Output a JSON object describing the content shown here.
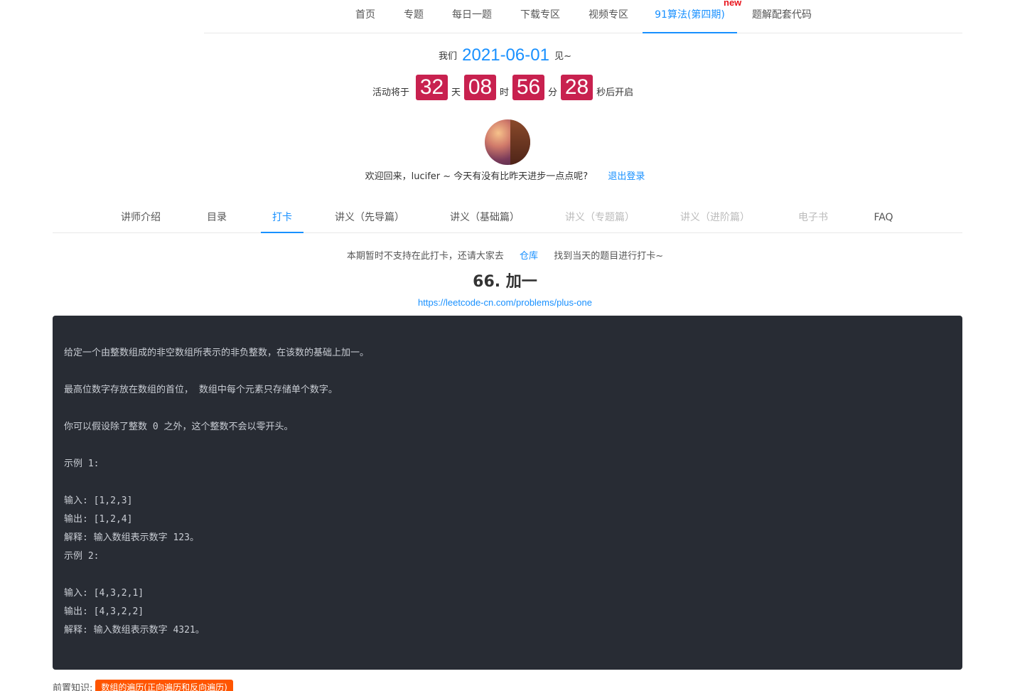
{
  "topnav": {
    "items": [
      {
        "label": "首页"
      },
      {
        "label": "专题"
      },
      {
        "label": "每日一题"
      },
      {
        "label": "下载专区"
      },
      {
        "label": "视频专区"
      },
      {
        "label": "91算法(第四期)"
      },
      {
        "label": "题解配套代码"
      }
    ],
    "active_index": 5,
    "new_badge": "new"
  },
  "countdown": {
    "prefix": "我们",
    "date": "2021-06-01",
    "suffix": "见~",
    "lead": "活动将于",
    "days": "32",
    "days_unit": "天",
    "hours": "08",
    "hours_unit": "时",
    "minutes": "56",
    "minutes_unit": "分",
    "seconds": "28",
    "tail": "秒后开启"
  },
  "user": {
    "welcome": "欢迎回来，lucifer ~ 今天有没有比昨天进步一点点呢?",
    "logout_label": "退出登录",
    "avatar_icon": "avatar-climber-image"
  },
  "subtabs": {
    "items": [
      {
        "label": "讲师介绍"
      },
      {
        "label": "目录"
      },
      {
        "label": "打卡"
      },
      {
        "label": "讲义（先导篇）"
      },
      {
        "label": "讲义（基础篇）"
      },
      {
        "label": "讲义（专题篇）"
      },
      {
        "label": "讲义（进阶篇）"
      },
      {
        "label": "电子书"
      },
      {
        "label": "FAQ"
      }
    ],
    "active_index": 2,
    "disabled_indices": [
      5,
      6,
      7
    ]
  },
  "notice": {
    "before": "本期暂时不支持在此打卡，还请大家去",
    "link": "仓库",
    "after": "找到当天的题目进行打卡~"
  },
  "problem": {
    "title": "66. 加一",
    "url": "https://leetcode-cn.com/problems/plus-one",
    "lines": [
      "给定一个由整数组成的非空数组所表示的非负整数，在该数的基础上加一。",
      "",
      "最高位数字存放在数组的首位， 数组中每个元素只存储单个数字。",
      "",
      "你可以假设除了整数 0 之外，这个整数不会以零开头。",
      "",
      "示例 1:",
      "",
      "输入: [1,2,3]",
      "输出: [1,2,4]",
      "解释: 输入数组表示数字 123。",
      "示例 2:",
      "",
      "输入: [4,3,2,1]",
      "输出: [4,3,2,2]",
      "解释: 输入数组表示数字 4321。"
    ]
  },
  "prereq": {
    "label": "前置知识:",
    "tag": "数组的遍历(正向遍历和反向遍历)"
  },
  "colors": {
    "accent": "#1890ff",
    "countdown_box": "#c8214f",
    "code_bg": "#282c34",
    "tag_bg": "#ff5500",
    "new_badge": "#e8141c"
  }
}
